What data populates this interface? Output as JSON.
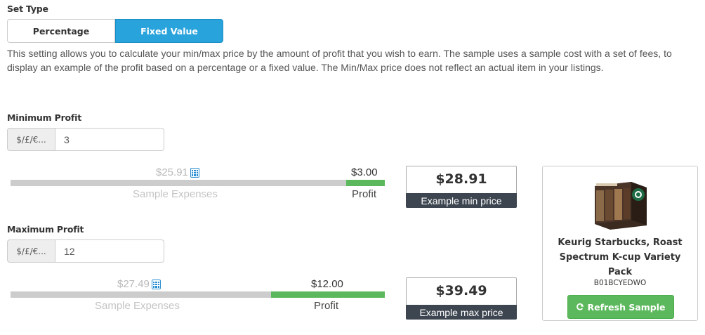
{
  "set_type": {
    "label": "Set Type",
    "options": [
      "Percentage",
      "Fixed Value"
    ],
    "selected": "Fixed Value"
  },
  "description": "This setting allows you to calculate your min/max price by the amount of profit that you wish to earn. The sample uses a sample cost with a set of fees, to display an example of the profit based on a percentage or a fixed value. The Min/Max price does not reflect an actual item in your listings.",
  "minimum": {
    "label": "Minimum Profit",
    "currency_addon": "$/£/€...",
    "value": "3",
    "expenses_value": "$25.91",
    "expenses_label": "Sample Expenses",
    "profit_value": "$3.00",
    "profit_label": "Profit",
    "profit_share": 0.104,
    "example_price": "$28.91",
    "example_caption": "Example min price"
  },
  "maximum": {
    "label": "Maximum Profit",
    "currency_addon": "$/£/€...",
    "value": "12",
    "expenses_value": "$27.49",
    "expenses_label": "Sample Expenses",
    "profit_value": "$12.00",
    "profit_label": "Profit",
    "profit_share": 0.304,
    "example_price": "$39.49",
    "example_caption": "Example max price"
  },
  "sample_product": {
    "title": "Keurig Starbucks, Roast Spectrum K-cup Variety Pack",
    "asin": "B01BCYEDWO",
    "refresh_label": "Refresh Sample"
  },
  "colors": {
    "accent_blue": "#29a3dc",
    "profit_green": "#5cb85c",
    "expenses_gray": "#cccccc",
    "caption_dark": "#3d4650"
  }
}
